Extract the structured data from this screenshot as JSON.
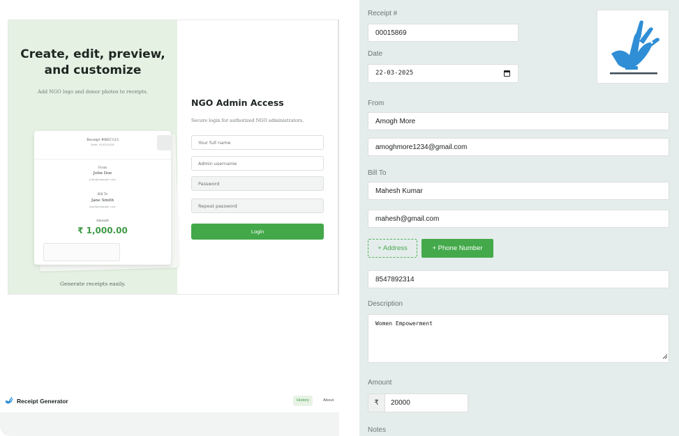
{
  "login_page": {
    "promo": {
      "title": "Create, edit, preview, and customize",
      "subtitle": "Add NGO logo and donor photos to receipts.",
      "footer": "Generate receipts easily.",
      "sample_receipt": {
        "receipt_no": "Receipt #REC123",
        "date": "Date: 01/01/2024",
        "from_label": "From",
        "from_name": "John Doe",
        "from_email": "john@example.com",
        "bill_to_label": "Bill To",
        "bill_to_name": "Jane Smith",
        "bill_to_email": "jane@example.com",
        "amount_label": "Amount",
        "amount_value": "₹ 1,000.00"
      }
    },
    "form": {
      "title": "NGO Admin Access",
      "subtitle": "Secure login for authorized NGO administrators.",
      "full_name_placeholder": "Your full name",
      "username_placeholder": "Admin username",
      "password_placeholder": "Password",
      "repeat_password_placeholder": "Repeat password",
      "login_label": "Login"
    },
    "accent_color": "#43a849",
    "promo_bg": "#e5f2e3"
  },
  "navbar": {
    "brand": "Receipt Generator",
    "brand_icon": "hand-dove-icon",
    "history_label": "History",
    "about_label": "About"
  },
  "receipt_form": {
    "receipt_no_label": "Receipt #",
    "receipt_no_value": "00015869",
    "date_label": "Date",
    "date_value": "22-03-2025",
    "logo_icon": "hand-dove-icon",
    "from_label": "From",
    "from_name": "Amogh More",
    "from_email": "amoghmore1234@gmail.com",
    "bill_to_label": "Bill To",
    "bill_to_name": "Mahesh Kumar",
    "bill_to_email": "mahesh@gmail.com",
    "add_address_label": "+ Address",
    "add_phone_label": "+ Phone Number",
    "phone_value": "8547892314",
    "description_label": "Description",
    "description_value": "Women Empowerment",
    "amount_label": "Amount",
    "currency_symbol": "₹",
    "amount_value": "20000",
    "notes_label": "Notes",
    "panel_bg": "#e4edeb"
  }
}
